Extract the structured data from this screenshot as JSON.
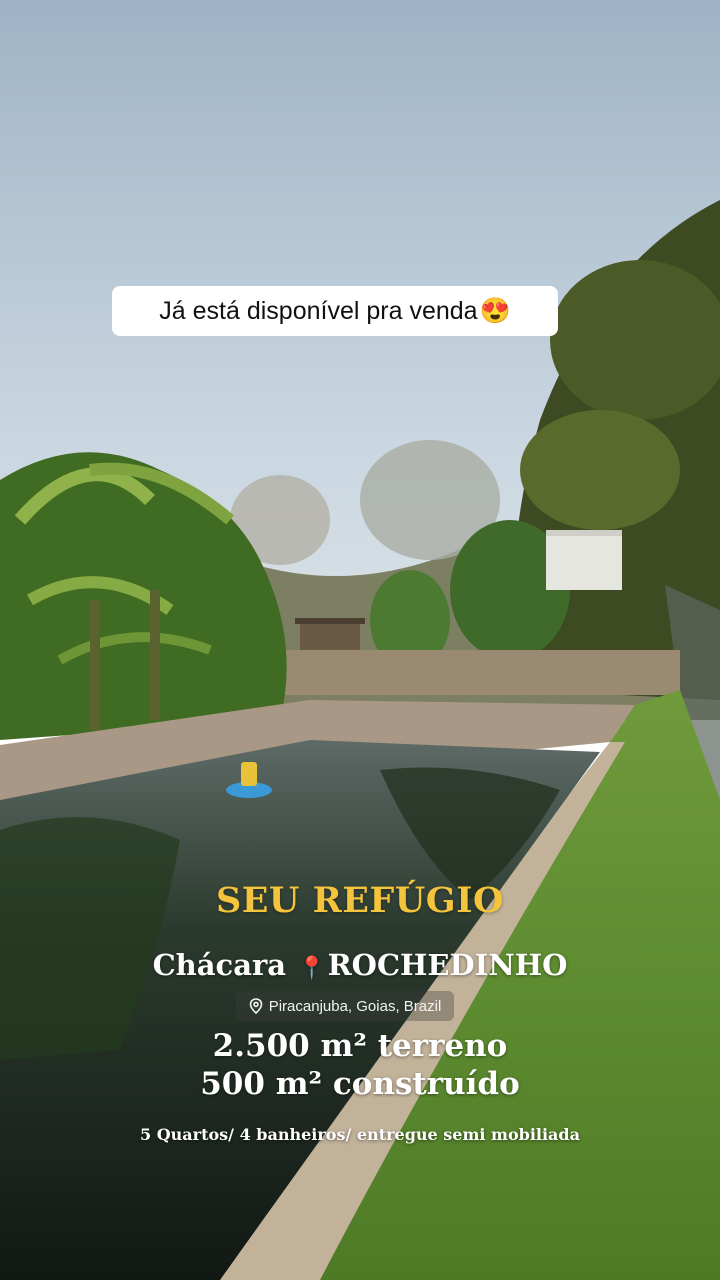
{
  "caption": {
    "text": "Já está disponível pra venda",
    "emoji": "😍"
  },
  "overlay": {
    "title": "SEU REFÚGIO",
    "property_type": "Chácara",
    "pin_emoji": "📍",
    "neighborhood": "ROCHEDINHO",
    "location": "Piracanjuba, Goias, Brazil",
    "land_area": "2.500 m² terreno",
    "built_area": "500 m² construído",
    "features": "5 Quartos/ 4 banheiros/ entregue semi mobiliada"
  },
  "colors": {
    "title_yellow": "#f4c43c",
    "caption_bg": "#ffffff"
  }
}
